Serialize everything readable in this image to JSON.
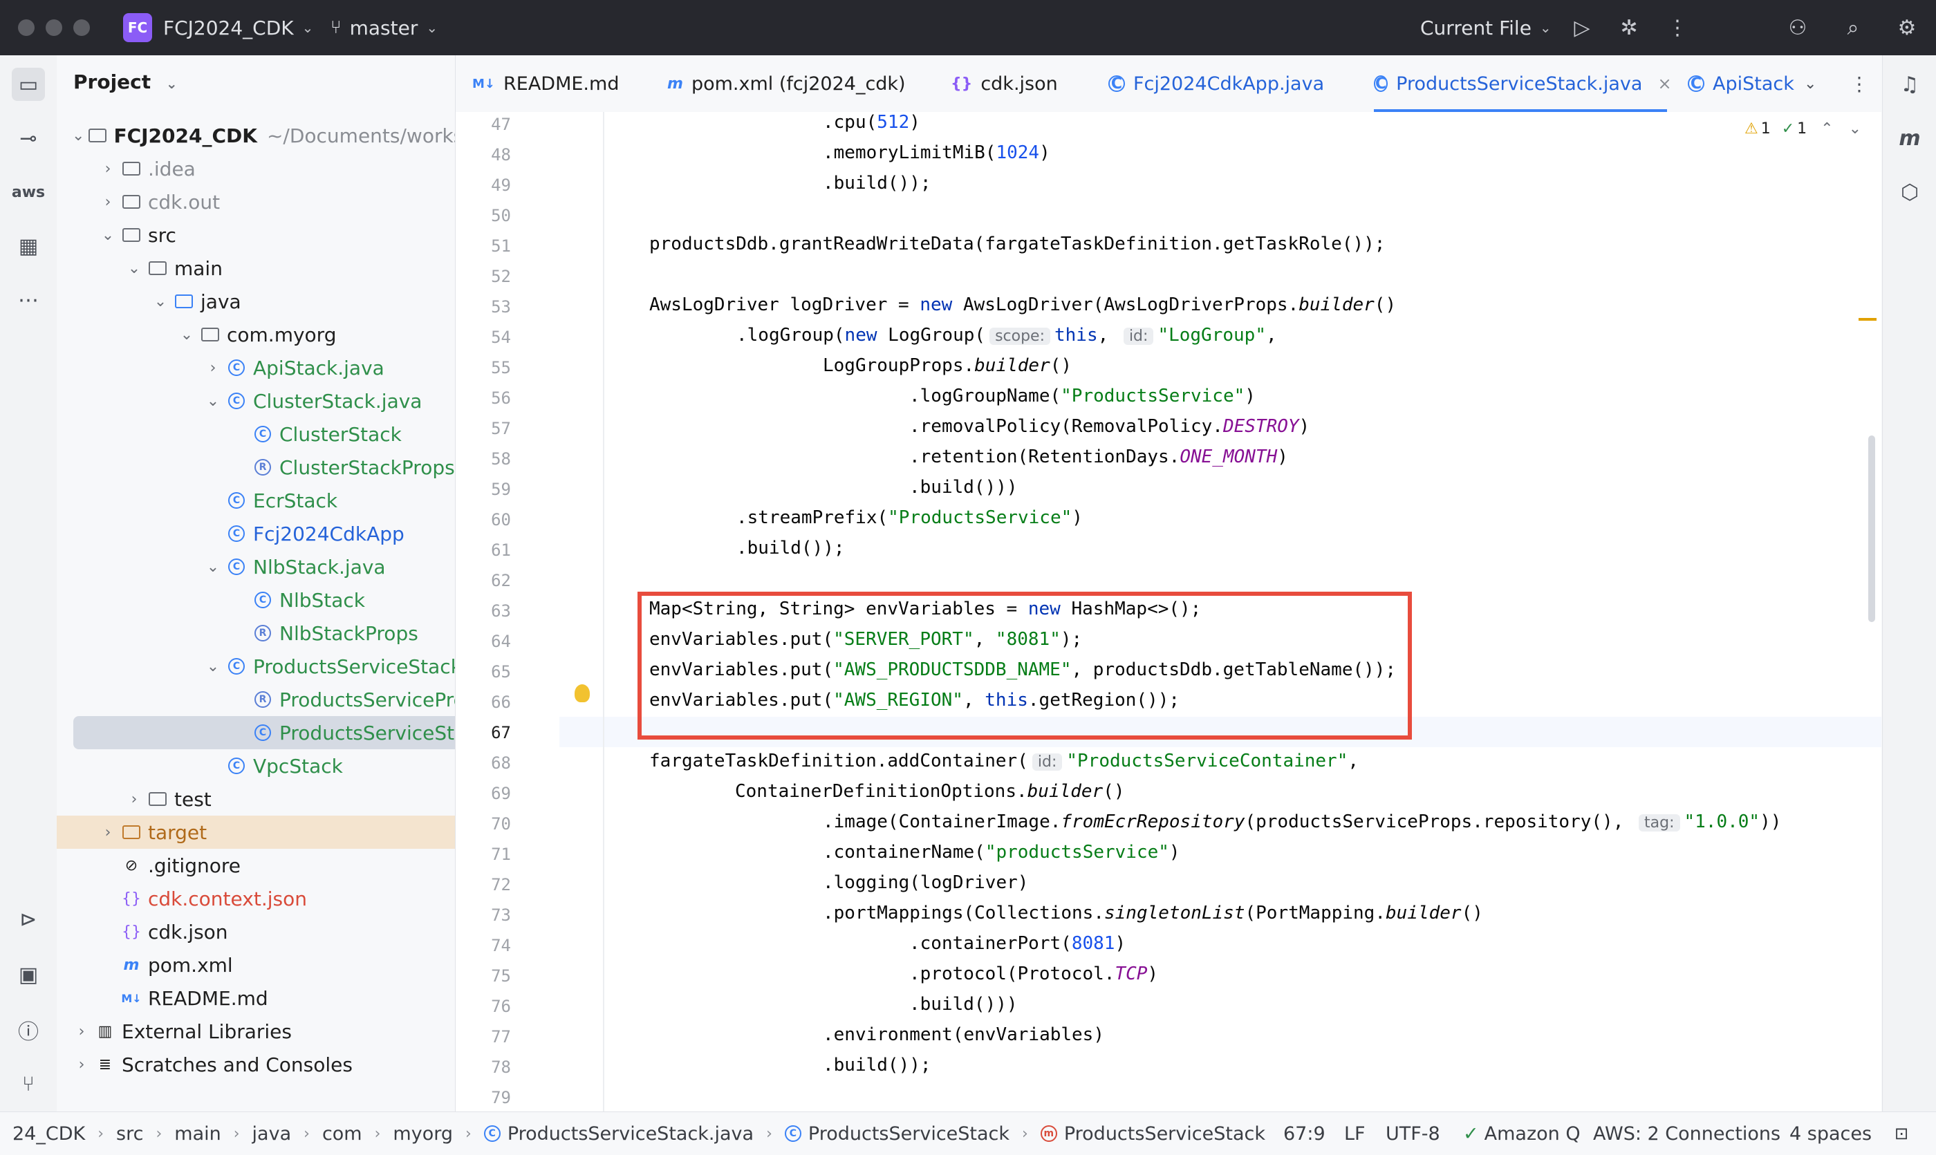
{
  "titlebar": {
    "project_badge": "FC",
    "project_name": "FCJ2024_CDK",
    "branch": "master",
    "run_config": "Current File"
  },
  "project_panel": {
    "title": "Project",
    "root_name": "FCJ2024_CDK",
    "root_path": "~/Documents/worksho",
    "items": [
      {
        "label": ".idea"
      },
      {
        "label": "cdk.out"
      },
      {
        "label": "src"
      },
      {
        "label": "main"
      },
      {
        "label": "java"
      },
      {
        "label": "com.myorg"
      },
      {
        "label": "ApiStack.java"
      },
      {
        "label": "ClusterStack.java"
      },
      {
        "label": "ClusterStack"
      },
      {
        "label": "ClusterStackProps"
      },
      {
        "label": "EcrStack"
      },
      {
        "label": "Fcj2024CdkApp"
      },
      {
        "label": "NlbStack.java"
      },
      {
        "label": "NlbStack"
      },
      {
        "label": "NlbStackProps"
      },
      {
        "label": "ProductsServiceStack.j"
      },
      {
        "label": "ProductsServicePro"
      },
      {
        "label": "ProductsServiceSta"
      },
      {
        "label": "VpcStack"
      },
      {
        "label": "test"
      },
      {
        "label": "target"
      },
      {
        "label": ".gitignore"
      },
      {
        "label": "cdk.context.json"
      },
      {
        "label": "cdk.json"
      },
      {
        "label": "pom.xml"
      },
      {
        "label": "README.md"
      },
      {
        "label": "External Libraries"
      },
      {
        "label": "Scratches and Consoles"
      }
    ]
  },
  "tabs": [
    {
      "label": "README.md"
    },
    {
      "label": "pom.xml (fcj2024_cdk)"
    },
    {
      "label": "cdk.json"
    },
    {
      "label": "Fcj2024CdkApp.java"
    },
    {
      "label": "ProductsServiceStack.java"
    },
    {
      "label": "ApiStack"
    }
  ],
  "inspections": {
    "warnings": "1",
    "ok": "1"
  },
  "editor": {
    "line_numbers": [
      "47",
      "48",
      "49",
      "50",
      "51",
      "52",
      "53",
      "54",
      "55",
      "56",
      "57",
      "58",
      "59",
      "60",
      "61",
      "62",
      "63",
      "64",
      "65",
      "66",
      "67",
      "68",
      "69",
      "70",
      "71",
      "72",
      "73",
      "74",
      "75",
      "76",
      "77",
      "78",
      "79"
    ],
    "hints": {
      "scope": "scope:",
      "id": "id:",
      "tag": "tag:"
    }
  },
  "statusbar": {
    "breadcrumb": [
      "24_CDK",
      "src",
      "main",
      "java",
      "com",
      "myorg",
      "ProductsServiceStack.java",
      "ProductsServiceStack",
      "ProductsServiceStack"
    ],
    "position": "67:9",
    "line_sep": "LF",
    "encoding": "UTF-8",
    "plugin": "Amazon Q",
    "aws": "AWS: 2 Connections",
    "indent": "4 spaces"
  }
}
